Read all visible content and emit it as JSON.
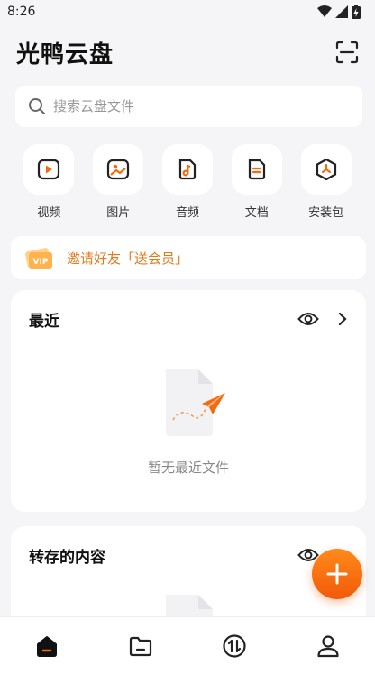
{
  "status_bar": {
    "time": "8:26"
  },
  "header": {
    "title": "光鸭云盘",
    "scan_icon": "scan-icon"
  },
  "search": {
    "placeholder": "搜索云盘文件",
    "value": ""
  },
  "categories": [
    {
      "label": "视频",
      "icon": "video-icon"
    },
    {
      "label": "图片",
      "icon": "image-icon"
    },
    {
      "label": "音频",
      "icon": "audio-icon"
    },
    {
      "label": "文档",
      "icon": "document-icon"
    },
    {
      "label": "安装包",
      "icon": "package-icon"
    }
  ],
  "invite": {
    "text": "邀请好友「送会员」",
    "icon": "vip-ticket-icon"
  },
  "recent": {
    "title": "最近",
    "empty_text": "暂无最近文件"
  },
  "transfer": {
    "title": "转存的内容"
  },
  "fab": {
    "icon": "plus-icon"
  },
  "bottom_nav": [
    {
      "name": "home",
      "icon": "home-icon",
      "active": true
    },
    {
      "name": "files",
      "icon": "folder-icon",
      "active": false
    },
    {
      "name": "transfer",
      "icon": "transfer-icon",
      "active": false
    },
    {
      "name": "profile",
      "icon": "user-icon",
      "active": false
    }
  ],
  "colors": {
    "accent": "#f36b10",
    "background": "#f5f5f7",
    "text": "#222222"
  }
}
